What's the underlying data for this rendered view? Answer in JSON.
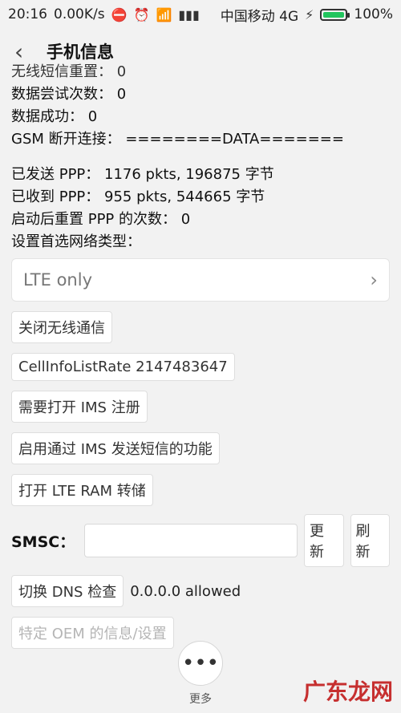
{
  "status": {
    "time": "20:16",
    "speed": "0.00K/s",
    "carrier": "中国移动 4G",
    "battery": "100%",
    "icons": [
      "muted-icon",
      "alarm-icon",
      "wifi-icon",
      "signal-icon",
      "charging-icon",
      "battery-icon"
    ]
  },
  "header": {
    "title": "手机信息"
  },
  "info": {
    "line0": "无线短信重置： 0",
    "line1": "数据尝试次数： 0",
    "line2": "数据成功： 0",
    "line3": "GSM 断开连接： ========DATA=======",
    "line4": "已发送 PPP： 1176 pkts, 196875 字节",
    "line5": "已收到 PPP： 955 pkts, 544665 字节",
    "line6": "启动后重置 PPP 的次数： 0",
    "line7": "设置首选网络类型："
  },
  "network_select": {
    "value": "LTE only"
  },
  "buttons": {
    "radio_off": "关闭无线通信",
    "cellinfo": "CellInfoListRate 2147483647",
    "ims_reg": "需要打开 IMS 注册",
    "ims_sms": "启用通过 IMS 发送短信的功能",
    "lte_ram": "打开 LTE RAM 转储",
    "update": "更新",
    "refresh": "刷新",
    "dns_toggle": "切换 DNS 检查",
    "oem": "特定 OEM 的信息/设置"
  },
  "smsc": {
    "label": "SMSC：",
    "value": ""
  },
  "dns": {
    "status": "0.0.0.0 allowed"
  },
  "more": {
    "label": "更多"
  },
  "watermark": "广东龙网"
}
